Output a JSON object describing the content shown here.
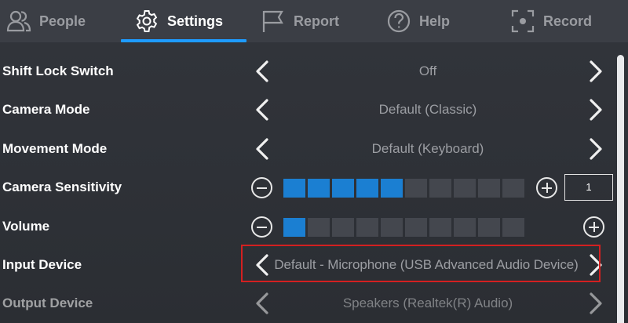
{
  "tabs": [
    {
      "label": "People",
      "icon": "people-icon",
      "active": false
    },
    {
      "label": "Settings",
      "icon": "gear-icon",
      "active": true
    },
    {
      "label": "Report",
      "icon": "flag-icon",
      "active": false
    },
    {
      "label": "Help",
      "icon": "help-icon",
      "active": false
    },
    {
      "label": "Record",
      "icon": "record-icon",
      "active": false
    }
  ],
  "settings": {
    "shift_lock": {
      "label": "Shift Lock Switch",
      "value": "Off"
    },
    "camera_mode": {
      "label": "Camera Mode",
      "value": "Default (Classic)"
    },
    "movement_mode": {
      "label": "Movement Mode",
      "value": "Default (Keyboard)"
    },
    "camera_sensitivity": {
      "label": "Camera Sensitivity",
      "level": 5,
      "segments": 10,
      "value": "1"
    },
    "volume": {
      "label": "Volume",
      "level": 1,
      "segments": 10
    },
    "input_device": {
      "label": "Input Device",
      "value": "Default - Microphone (USB Advanced Audio Device)"
    },
    "output_device": {
      "label": "Output Device",
      "value": "Speakers (Realtek(R) Audio)"
    }
  },
  "colors": {
    "accent": "#1e9bff",
    "segment_on": "#1b7fd2",
    "segment_off": "#44474e",
    "highlight": "#d32020"
  }
}
